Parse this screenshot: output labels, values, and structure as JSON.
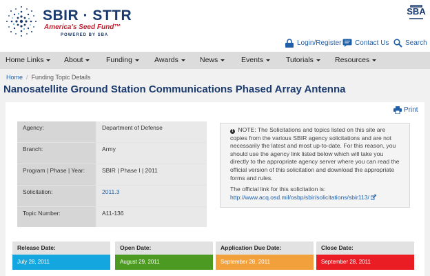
{
  "brand": {
    "title_a": "SBIR",
    "title_sep": "·",
    "title_b": "STTR",
    "tagline": "America's Seed Fund™",
    "powered": "POWERED BY SBA",
    "sba_logo_text": "SBA"
  },
  "util_nav": {
    "login": "Login/Register",
    "contact": "Contact Us",
    "search": "Search"
  },
  "main_nav": [
    "Home Links",
    "About",
    "Funding",
    "Awards",
    "News",
    "Events",
    "Tutorials",
    "Resources"
  ],
  "breadcrumb": {
    "home": "Home",
    "current": "Funding Topic Details"
  },
  "page_title": "Nanosatellite Ground Station Communications Phased Array Antenna",
  "print_label": "Print",
  "details": [
    {
      "label": "Agency:",
      "value": "Department of Defense"
    },
    {
      "label": "Branch:",
      "value": "Army"
    },
    {
      "label": "Program | Phase | Year:",
      "value": "SBIR | Phase I | 2011"
    },
    {
      "label": "Solicitation:",
      "value": "2011.3"
    },
    {
      "label": "Topic Number:",
      "value": "A11-136"
    }
  ],
  "notice": {
    "text": "NOTE: The Solicitations and topics listed on this site are copies from the various SBIR agency solicitations and are not necessarily the latest and most up-to-date. For this reason, you should use the agency link listed below which will take you directly to the appropriate agency server where you can read the official version of this solicitation and download the appropriate forms and rules.",
    "official_link_label": "The official link for this solicitation is:",
    "official_link": "http://www.acq.osd.mil/osbp/sbir/solicitations/sbir113/"
  },
  "dates": [
    {
      "label": "Release Date:",
      "value": "July 28, 2011",
      "color": "#13a6df"
    },
    {
      "label": "Open Date:",
      "value": "August 29, 2011",
      "color": "#4d9a22"
    },
    {
      "label": "Application Due Date:",
      "value": "September 28, 2011",
      "color": "#f2a03c"
    },
    {
      "label": "Close Date:",
      "value": "September 28, 2011",
      "color": "#ea1d25"
    }
  ],
  "colors": {
    "brand_navy": "#1a3a6e",
    "link_blue": "#1f5fa8",
    "tagline_red": "#c21f2f"
  }
}
